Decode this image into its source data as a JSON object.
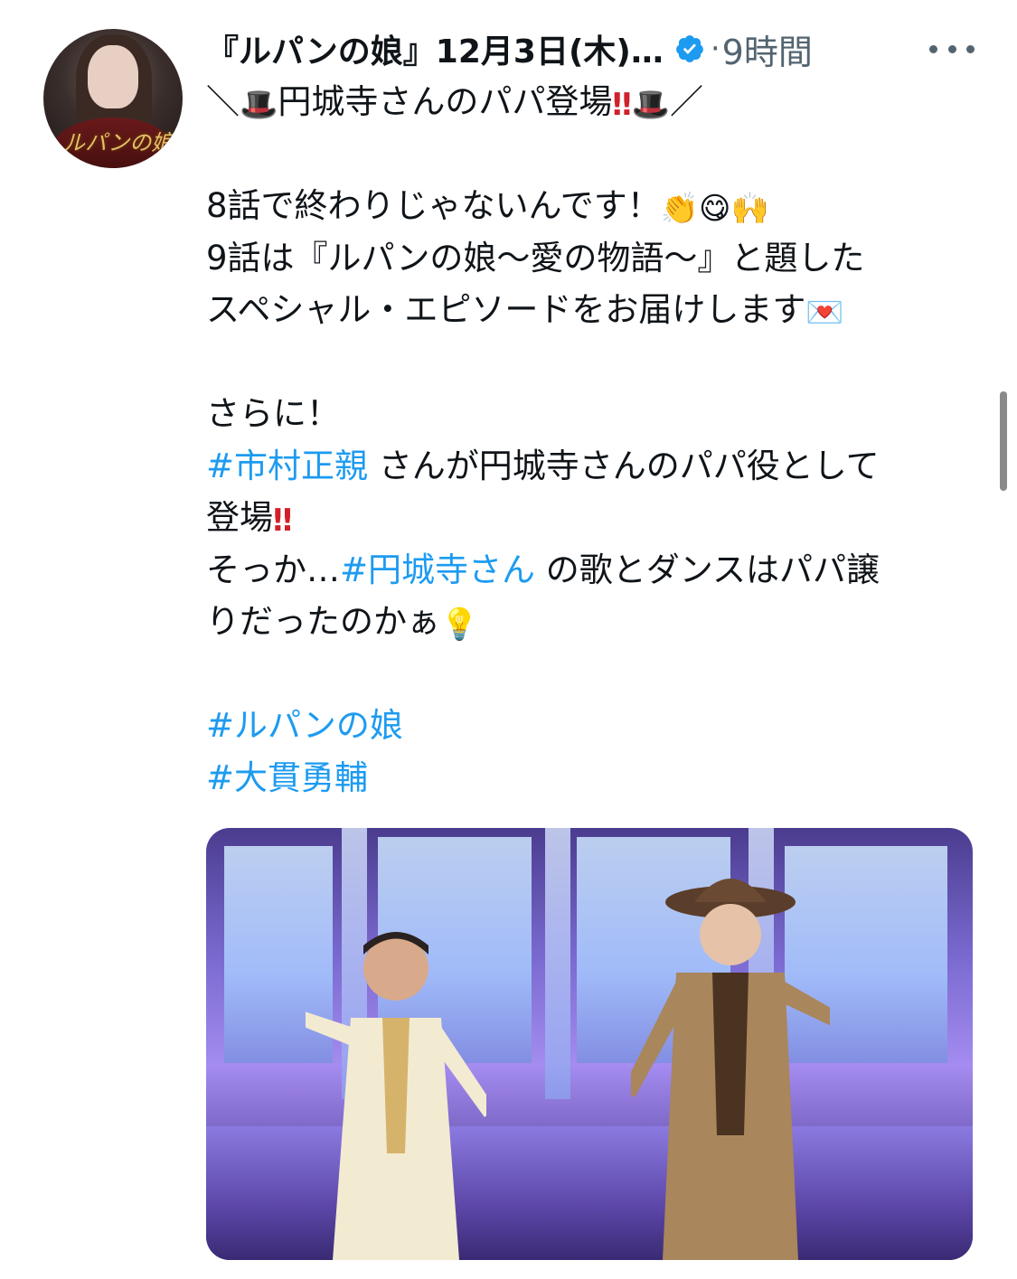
{
  "author": {
    "display_name": "『ルパンの娘』12月3日(木)…",
    "verified": true,
    "separator": "·",
    "time": "9時間",
    "avatar_logo": "ルパンの娘"
  },
  "tweet": {
    "line1_pre": "＼",
    "line1_text": "円城寺さんのパパ登場",
    "line1_post": "／",
    "line2": "8話で終わりじゃないんです！",
    "line3": "9話は『ルパンの娘〜愛の物語〜』と題した",
    "line4": "スペシャル・エピソードをお届けします",
    "line5": "さらに！",
    "line6_tag": "#市村正親",
    "line6_text": " さんが円城寺さんのパパ役として",
    "line7": "登場",
    "line8_pre": "そっか…",
    "line8_tag": "#円城寺さん",
    "line8_text": " の歌とダンスはパパ譲",
    "line9": "りだったのかぁ",
    "tag1": "#ルパンの娘",
    "tag2": "#大貫勇輔"
  },
  "emoji": {
    "top_hat": "🎩",
    "double_exclamation": "‼",
    "clap": "👏",
    "yum": "😋",
    "raised_hands": "🙌",
    "love_letter": "💌",
    "bulb": "💡"
  },
  "colors": {
    "text": "#0f1419",
    "secondary": "#536471",
    "link": "#1d9bf0",
    "verified": "#1d9bf0"
  }
}
